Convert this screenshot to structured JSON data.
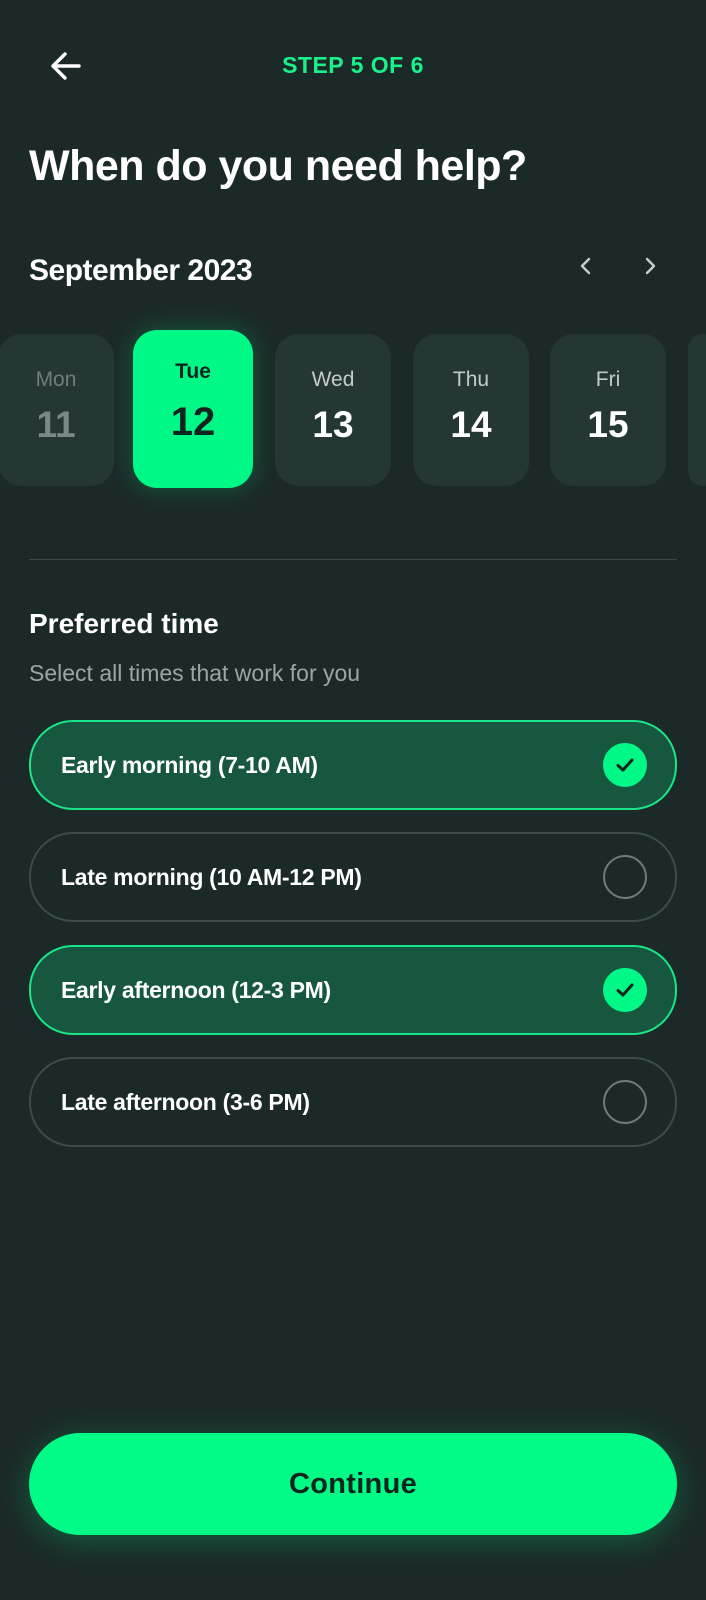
{
  "header": {
    "back_icon": "arrow-left-icon",
    "step_label": "STEP 5 OF 6"
  },
  "title": "When do you need help?",
  "calendar": {
    "month_label": "September 2023",
    "prev_icon": "chevron-left-icon",
    "next_icon": "chevron-right-icon",
    "days": [
      {
        "dow": "Mon",
        "num": "11",
        "state": "past"
      },
      {
        "dow": "Tue",
        "num": "12",
        "state": "selected"
      },
      {
        "dow": "Wed",
        "num": "13",
        "state": "available"
      },
      {
        "dow": "Thu",
        "num": "14",
        "state": "available"
      },
      {
        "dow": "Fri",
        "num": "15",
        "state": "available"
      }
    ]
  },
  "preferred_time": {
    "title": "Preferred time",
    "subtitle": "Select all times that work for you",
    "options": [
      {
        "label": "Early morning (7-10 AM)",
        "checked": true
      },
      {
        "label": "Late morning (10 AM-12 PM)",
        "checked": false
      },
      {
        "label": "Early afternoon (12-3 PM)",
        "checked": true
      },
      {
        "label": "Late afternoon (3-6 PM)",
        "checked": false
      }
    ]
  },
  "continue_label": "Continue",
  "colors": {
    "background": "#1b2a28",
    "accent": "#00f986",
    "card": "#253735",
    "checked_option_bg": "#17573f"
  }
}
